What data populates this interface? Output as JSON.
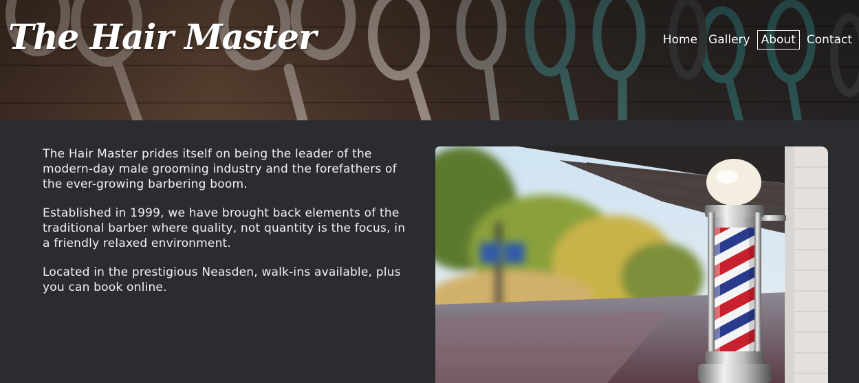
{
  "header": {
    "brand": "The Hair Master",
    "nav": [
      {
        "label": "Home",
        "active": false
      },
      {
        "label": "Gallery",
        "active": false
      },
      {
        "label": "About",
        "active": true
      },
      {
        "label": "Contact",
        "active": false
      }
    ],
    "background_image": "scissors-wall"
  },
  "main": {
    "paragraphs": [
      "The Hair Master prides itself on being the leader of the modern-day male grooming industry and the forefathers of the ever-growing barbering boom.",
      "Established in 1999, we have brought back elements of the traditional barber where quality, not quantity is the focus, in a friendly relaxed environment.",
      "Located in the prestigious Neasden, walk-ins available, plus you can book online."
    ],
    "photo": "barber-pole-street"
  },
  "colors": {
    "page_background": "#2b2c30",
    "text": "#ffffff",
    "pole_red": "#c8202c",
    "pole_blue": "#2a3a8c"
  }
}
